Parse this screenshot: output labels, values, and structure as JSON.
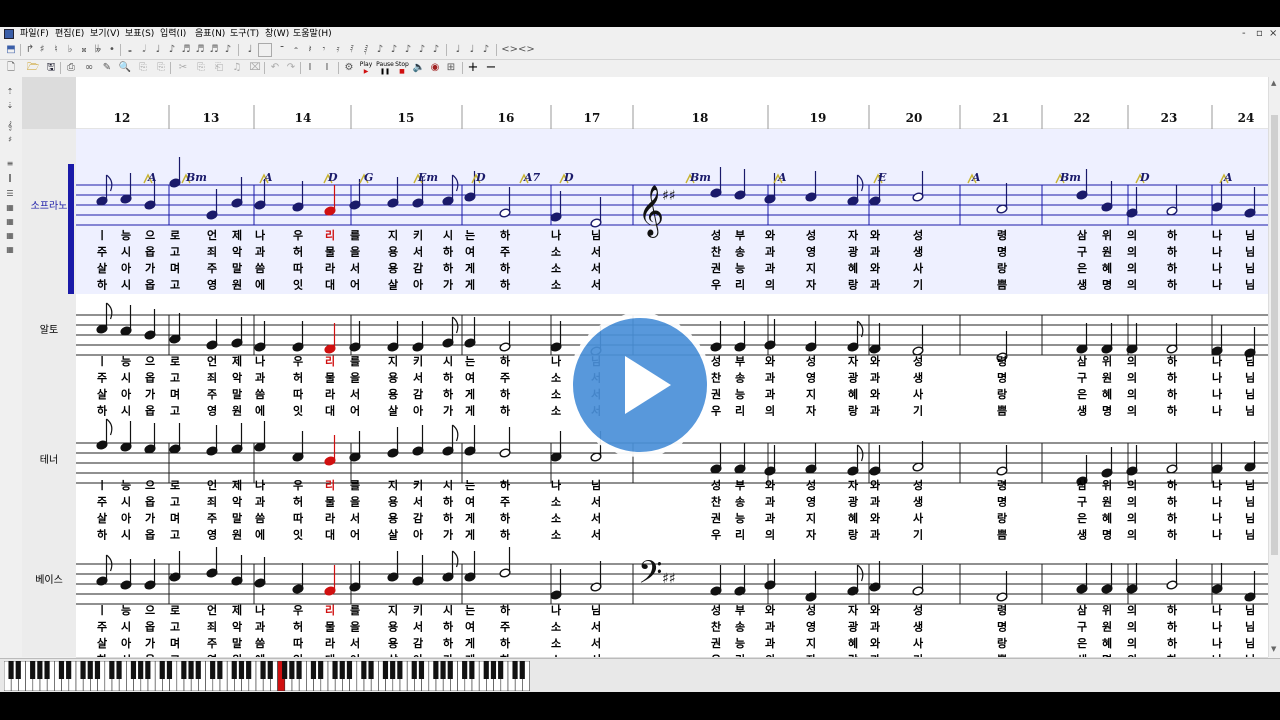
{
  "menu": {
    "items": [
      "파일(F)",
      "편집(E)",
      "보기(V)",
      "보표(S)",
      "입력(I)",
      "음표(N)",
      "도구(T)",
      "창(W)",
      "도움말(H)"
    ],
    "window_controls": [
      "-",
      "▫",
      "×"
    ]
  },
  "toolbar": {
    "play_label": "Play",
    "pause_label": "Pause",
    "stop_label": "Stop"
  },
  "ruler": {
    "measures": [
      "12",
      "13",
      "14",
      "15",
      "16",
      "17",
      "18",
      "19",
      "20",
      "21",
      "22",
      "23",
      "24"
    ]
  },
  "parts": [
    {
      "name": "소프라노"
    },
    {
      "name": "알토"
    },
    {
      "name": "테너"
    },
    {
      "name": "베이스"
    }
  ],
  "chords": [
    "A",
    "Bm",
    "A",
    "D",
    "G",
    "Em",
    "D",
    "A7",
    "D",
    "Bm",
    "A",
    "E",
    "A",
    "Bm",
    "D",
    "A"
  ],
  "lyrics": {
    "soprano_alto": [
      [
        "ㅣ",
        "능",
        "으",
        "로",
        "언",
        "제",
        "나",
        "우",
        "리",
        "를",
        "지",
        "키",
        "시",
        "는",
        "하",
        "나",
        "님",
        "성",
        "부",
        "와",
        "성",
        "자",
        "와",
        "성",
        "령",
        "삼",
        "위",
        "의",
        "하",
        "나",
        "님"
      ],
      [
        "주",
        "시",
        "옵",
        "고",
        "죄",
        "악",
        "과",
        "허",
        "물",
        "을",
        "용",
        "서",
        "하",
        "여",
        "주",
        "소",
        "서",
        "찬",
        "송",
        "과",
        "영",
        "광",
        "과",
        "생",
        "명",
        "구",
        "원",
        "의",
        "하",
        "나",
        "님"
      ],
      [
        "살",
        "아",
        "가",
        "며",
        "주",
        "말",
        "씀",
        "따",
        "라",
        "서",
        "용",
        "감",
        "하",
        "게",
        "하",
        "소",
        "서",
        "권",
        "능",
        "과",
        "지",
        "혜",
        "와",
        "사",
        "랑",
        "은",
        "혜",
        "의",
        "하",
        "나",
        "님"
      ],
      [
        "하",
        "시",
        "옵",
        "고",
        "영",
        "원",
        "에",
        "잇",
        "대",
        "어",
        "살",
        "아",
        "가",
        "게",
        "하",
        "소",
        "서",
        "우",
        "리",
        "의",
        "자",
        "랑",
        "과",
        "기",
        "쁨",
        "생",
        "명",
        "의",
        "하",
        "나",
        "님"
      ]
    ],
    "tenor_bass": [
      [
        "ㅣ",
        "능",
        "으",
        "로",
        "언",
        "제",
        "나",
        "우",
        "리",
        "를",
        "지",
        "키",
        "시",
        "는",
        "하",
        "나",
        "님",
        "성",
        "부",
        "와",
        "성",
        "자",
        "와",
        "성",
        "령",
        "삼",
        "위",
        "의",
        "하",
        "나",
        "님"
      ],
      [
        "주",
        "시",
        "옵",
        "고",
        "죄",
        "악",
        "과",
        "허",
        "물",
        "을",
        "용",
        "서",
        "하",
        "여",
        "주",
        "소",
        "서",
        "찬",
        "송",
        "과",
        "영",
        "광",
        "과",
        "생",
        "명",
        "구",
        "원",
        "의",
        "하",
        "나",
        "님"
      ],
      [
        "살",
        "아",
        "가",
        "며",
        "주",
        "말",
        "씀",
        "따",
        "라",
        "서",
        "용",
        "감",
        "하",
        "게",
        "하",
        "소",
        "서",
        "권",
        "능",
        "과",
        "지",
        "혜",
        "와",
        "사",
        "랑",
        "은",
        "혜",
        "의",
        "하",
        "나",
        "님"
      ],
      [
        "하",
        "시",
        "옵",
        "고",
        "영",
        "원",
        "에",
        "잇",
        "대",
        "어",
        "살",
        "아",
        "가",
        "게",
        "하",
        "소",
        "서",
        "우",
        "리",
        "의",
        "자",
        "랑",
        "과",
        "기",
        "쁨",
        "생",
        "명",
        "의",
        "하",
        "나",
        "님"
      ]
    ]
  },
  "colors": {
    "selected_part": "#1a1aa8",
    "chord_mark": "#c8b432",
    "highlight_note": "#d01010",
    "lyric": "#000000",
    "play_button": "#4a90d9"
  },
  "icons": {
    "play_overlay": "play-triangle-icon",
    "treble_clef": "treble-clef-icon",
    "bass_clef": "bass-clef-icon"
  }
}
